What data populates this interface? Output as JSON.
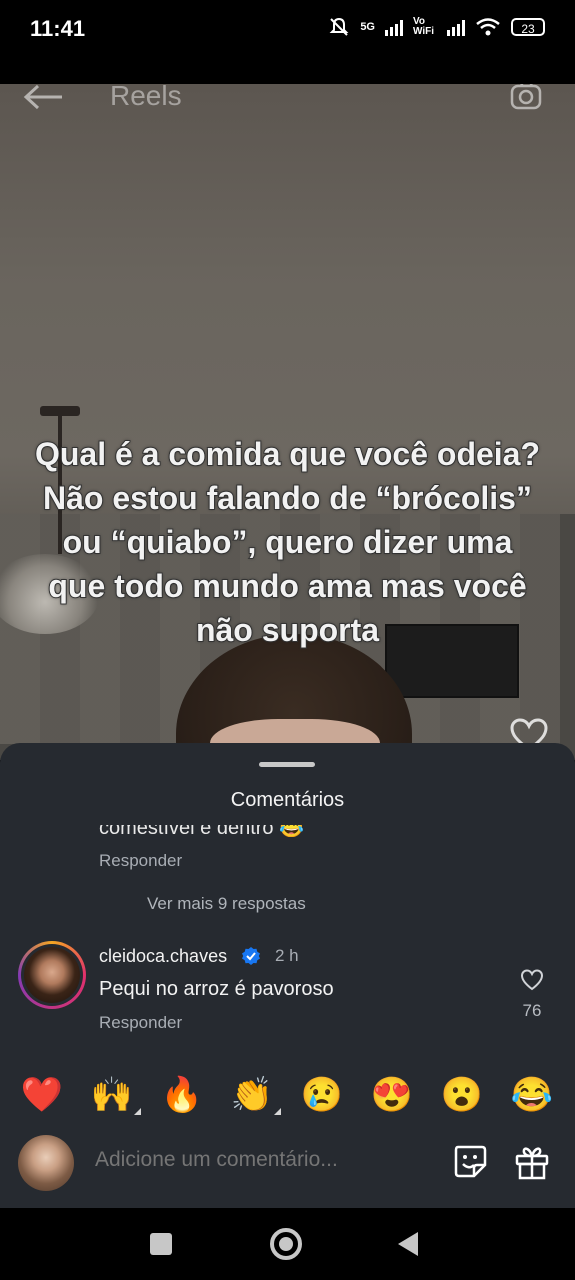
{
  "status_bar": {
    "time": "11:41",
    "network_5g": "5G",
    "vo_wifi": "Vo WiFi",
    "battery": "23"
  },
  "header": {
    "title": "Reels",
    "back_icon": "arrow-left-icon",
    "camera_icon": "camera-icon"
  },
  "video": {
    "overlay_text": "Qual é a comida que você odeia? Não estou falando de “brócolis” ou “quiabo”, quero dizer uma que todo mundo ama mas você não suporta",
    "like_icon": "heart-outline-icon"
  },
  "comments_sheet": {
    "title": "Comentários",
    "partial_previous_text": "comestível é dentro 😂",
    "previous_reply_label": "Responder",
    "view_more_replies": "Ver mais 9 respostas",
    "comment": {
      "username": "cleidoca.chaves",
      "verified": true,
      "time_ago": "2 h",
      "text": "Pequi no arroz é pavoroso",
      "reply_label": "Responder",
      "like_count": "76"
    },
    "emoji_reactions": [
      "❤️",
      "🙌",
      "🔥",
      "👏",
      "😢",
      "😍",
      "😮",
      "😂"
    ],
    "input": {
      "placeholder": "Adicione um comentário..."
    },
    "accent_color": "#1877f2"
  },
  "nav_bar": {
    "buttons": [
      "recent-apps",
      "home",
      "back"
    ]
  }
}
